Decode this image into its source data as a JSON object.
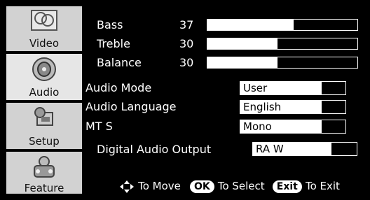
{
  "sidebar": {
    "tabs": [
      {
        "label": "Video",
        "icon": "video-icon"
      },
      {
        "label": "Audio",
        "icon": "speaker-icon"
      },
      {
        "label": "Setup",
        "icon": "setup-icon"
      },
      {
        "label": "Feature",
        "icon": "feature-icon"
      }
    ],
    "active_tab": "Audio"
  },
  "levels": {
    "bass": {
      "label": "Bass",
      "value": "37",
      "fraction": 0.37
    },
    "treble": {
      "label": "Treble",
      "value": "30",
      "fraction": 0.3
    },
    "balance": {
      "label": "Balance",
      "value": "30",
      "fraction": 0.3
    }
  },
  "settings": {
    "audio_mode": {
      "label": "Audio  Mode",
      "value": "User"
    },
    "audio_language": {
      "label": "Audio  Language",
      "value": "English"
    },
    "mts": {
      "label": "MT S",
      "value": "Mono"
    },
    "digital_audio_output": {
      "label": "Digital  Audio  Output",
      "value": "RA W"
    }
  },
  "footer": {
    "move_text": "To Move",
    "ok_key": "OK",
    "select_text": "To Select",
    "exit_key": "Exit",
    "exit_text": "To Exit"
  },
  "colors": {
    "background": "#000000",
    "tab": "#d2d2d2",
    "text": "#ffffff"
  }
}
